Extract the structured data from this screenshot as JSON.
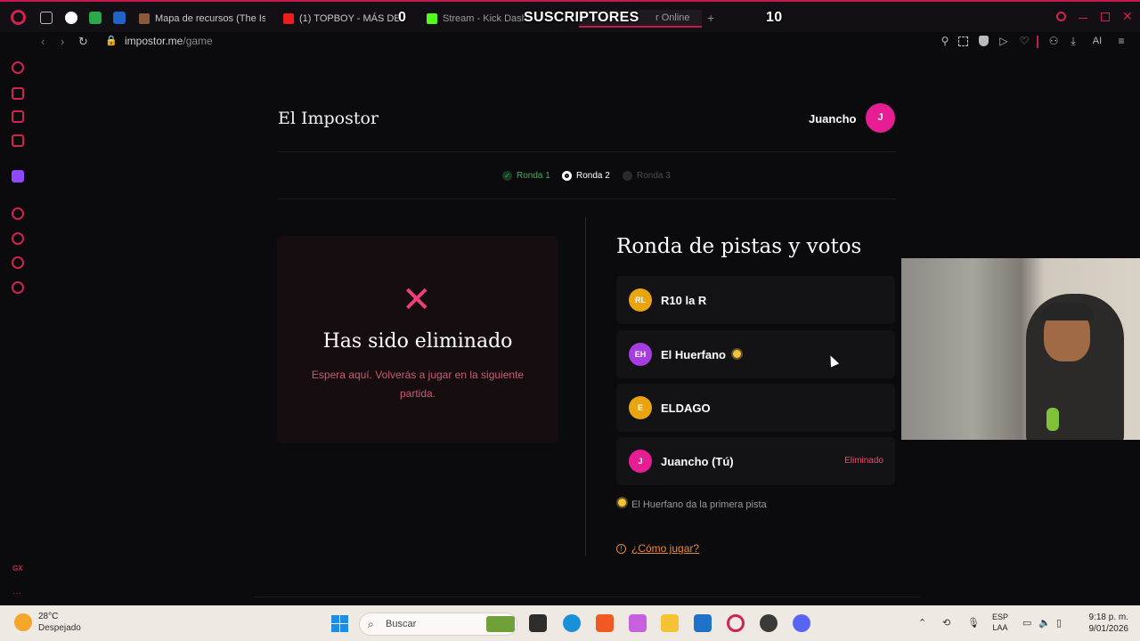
{
  "overlay": {
    "label": "SUSCRIPTORES",
    "left_count": "0",
    "right_count": "10"
  },
  "tabs": [
    {
      "label": "Mapa de recursos (The Isl"
    },
    {
      "label": "(1) TOPBOY - MÁS DE A"
    },
    {
      "label": "Stream - Kick Dashb"
    },
    {
      "label": "r Online"
    }
  ],
  "address": {
    "host": "impostor.me",
    "path": "/game"
  },
  "toolbar": {
    "ai_label": "AI"
  },
  "app": {
    "brand": "El Impostor",
    "user_name": "Juancho",
    "user_initial": "J"
  },
  "rounds": [
    {
      "label": "Ronda 1",
      "state": "done"
    },
    {
      "label": "Ronda 2",
      "state": "current"
    },
    {
      "label": "Ronda 3",
      "state": "pending"
    }
  ],
  "eliminated": {
    "title": "Has sido eliminado",
    "message": "Espera aquí. Volverás a jugar en la siguiente partida."
  },
  "votes": {
    "title": "Ronda de pistas y votos",
    "players": [
      {
        "initials": "RL",
        "name": "R10 la R",
        "color": "#e9a50f",
        "badge": ""
      },
      {
        "initials": "EH",
        "name": "El Huerfano",
        "color": "#a63de0",
        "badge": ""
      },
      {
        "initials": "E",
        "name": "ELDAGO",
        "color": "#e9a50f",
        "badge": ""
      },
      {
        "initials": "J",
        "name": "Juancho (Tú)",
        "color": "#e61d93",
        "badge": "Eliminado"
      }
    ],
    "first_hint": "El Huerfano da la primera pista",
    "how_to_play": "¿Cómo jugar?"
  },
  "taskbar": {
    "temperature": "28°C",
    "weather": "Despejado",
    "search_placeholder": "Buscar",
    "lang_line1": "ESP",
    "lang_line2": "LAA",
    "time": "9:18 p. m.",
    "date": "9/01/2026"
  },
  "colors": {
    "accent": "#e61d93",
    "opera_red": "#d0234f",
    "eliminated_red": "#ef4b72",
    "link_orange": "#e58a3a"
  }
}
